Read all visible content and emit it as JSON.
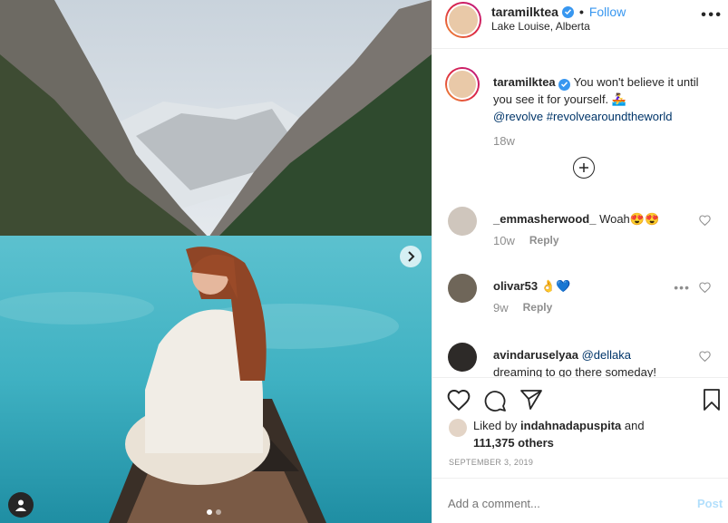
{
  "post": {
    "username": "taramilktea",
    "follow_label": "Follow",
    "dot": "•",
    "location": "Lake Louise, Alberta",
    "more_icon": "more-horizontal-icon",
    "photo": {
      "description_icon": "lake-photo",
      "carousel_count": 2,
      "carousel_active": 0
    }
  },
  "caption": {
    "username": "taramilktea",
    "text": " You won't believe it until you see it for yourself. 🚣‍♀️",
    "mention": "@revolve",
    "hashtag": "#revolvearoundtheworld",
    "time": "18w"
  },
  "comments": [
    {
      "username": "_emmasherwood_",
      "text": "Woah😍😍",
      "time": "10w",
      "reply": "Reply",
      "has_more": false
    },
    {
      "username": "olivar53",
      "text": "👌💙",
      "time": "9w",
      "reply": "Reply",
      "has_more": true
    },
    {
      "username": "avindaruselyaa",
      "mention": "@dellaka",
      "text": "dreaming to go there someday!",
      "time": "",
      "reply": "",
      "has_more": false
    }
  ],
  "likes": {
    "prefix": "Liked by ",
    "user": "indahnadapuspita",
    "and": " and",
    "count": "111,375 others"
  },
  "date": "SEPTEMBER 3, 2019",
  "add_comment": {
    "placeholder": "Add a comment...",
    "post_label": "Post"
  },
  "colors": {
    "link": "#3897f0",
    "tag": "#003569",
    "muted": "#8e8e8e",
    "post_disabled": "#b2dffc"
  }
}
